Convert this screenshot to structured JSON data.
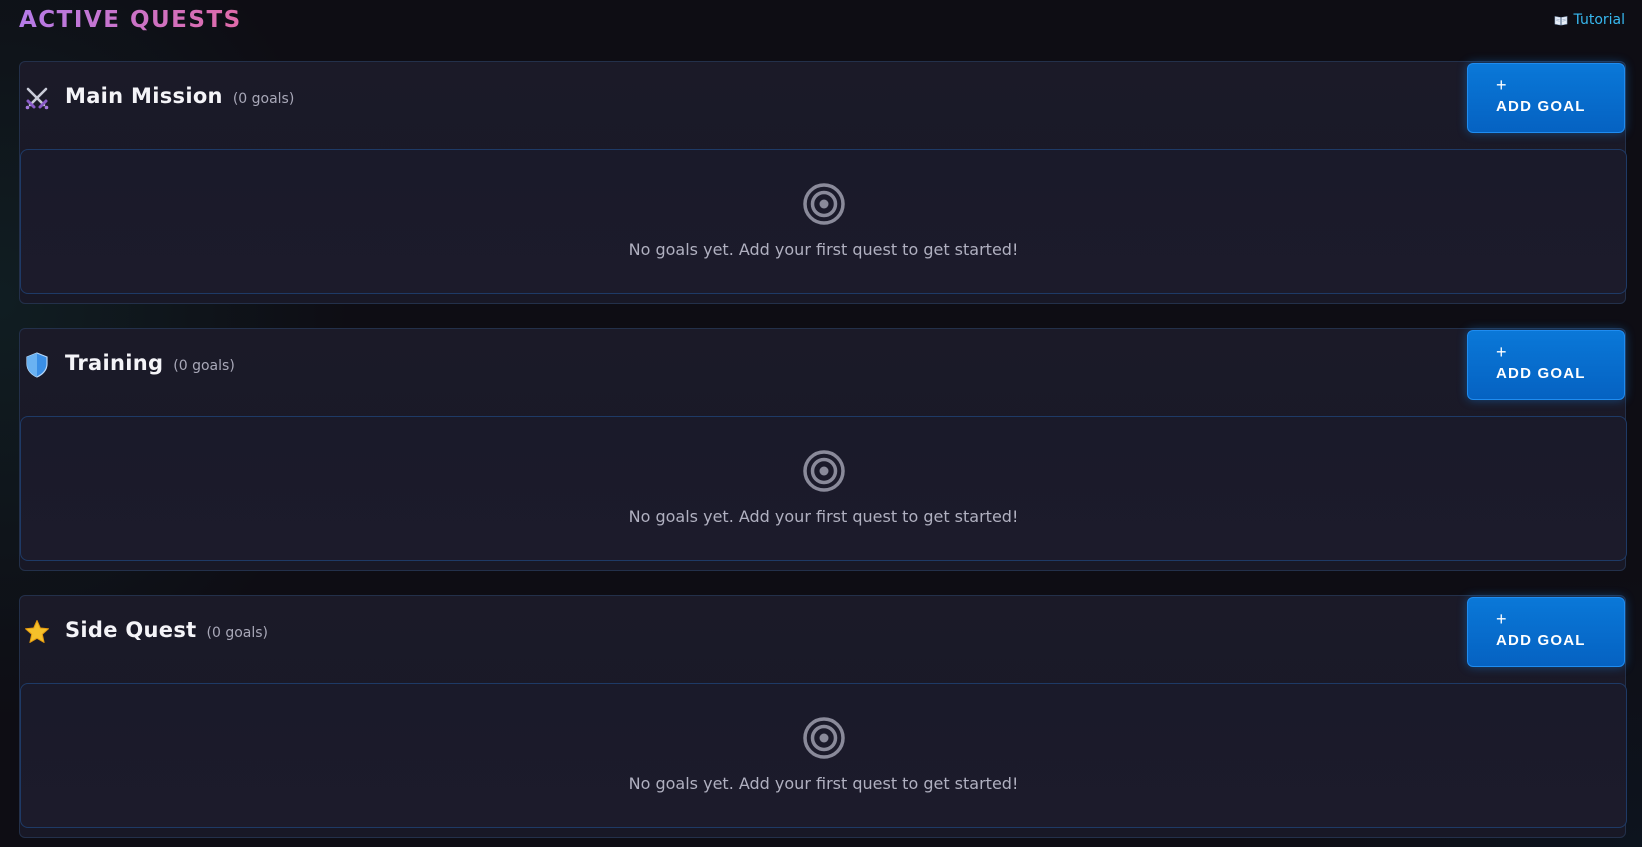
{
  "header": {
    "title": "ACTIVE QUESTS",
    "tutorial_label": "Tutorial",
    "tutorial_icon": "book-icon",
    "accent_color": "#37b8f0"
  },
  "sections": [
    {
      "title": "Main Mission",
      "count_label": "(0 goals)",
      "icon": "crossed-swords-icon",
      "add_plus": "+",
      "add_label": "ADD GOAL",
      "empty_text": "No goals yet. Add your first quest to get started!"
    },
    {
      "title": "Training",
      "count_label": "(0 goals)",
      "icon": "shield-icon",
      "add_plus": "+",
      "add_label": "ADD GOAL",
      "empty_text": "No goals yet. Add your first quest to get started!"
    },
    {
      "title": "Side Quest",
      "count_label": "(0 goals)",
      "icon": "star-icon",
      "add_plus": "+",
      "add_label": "ADD GOAL",
      "empty_text": "No goals yet. Add your first quest to get started!"
    }
  ],
  "colors": {
    "button": "#0a6fd2",
    "title_gradient_start": "#b57be8",
    "title_gradient_end": "#e06aa8"
  }
}
